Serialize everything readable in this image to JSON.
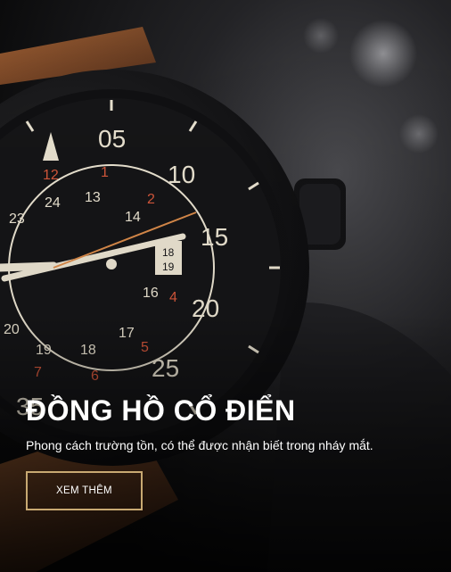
{
  "hero": {
    "title": "ĐỒNG HỒ CỔ ĐIỂN",
    "subtitle": "Phong cách trường tồn, có thể được nhận biết trong nháy mắt.",
    "button_label": "XEM THÊM",
    "image_icon": "wristwatch-photo",
    "colors": {
      "accent_border": "#c8a972",
      "text": "#ffffff",
      "dial_numeral": "#e9e2d0",
      "red_numeral": "#d4573b"
    }
  }
}
